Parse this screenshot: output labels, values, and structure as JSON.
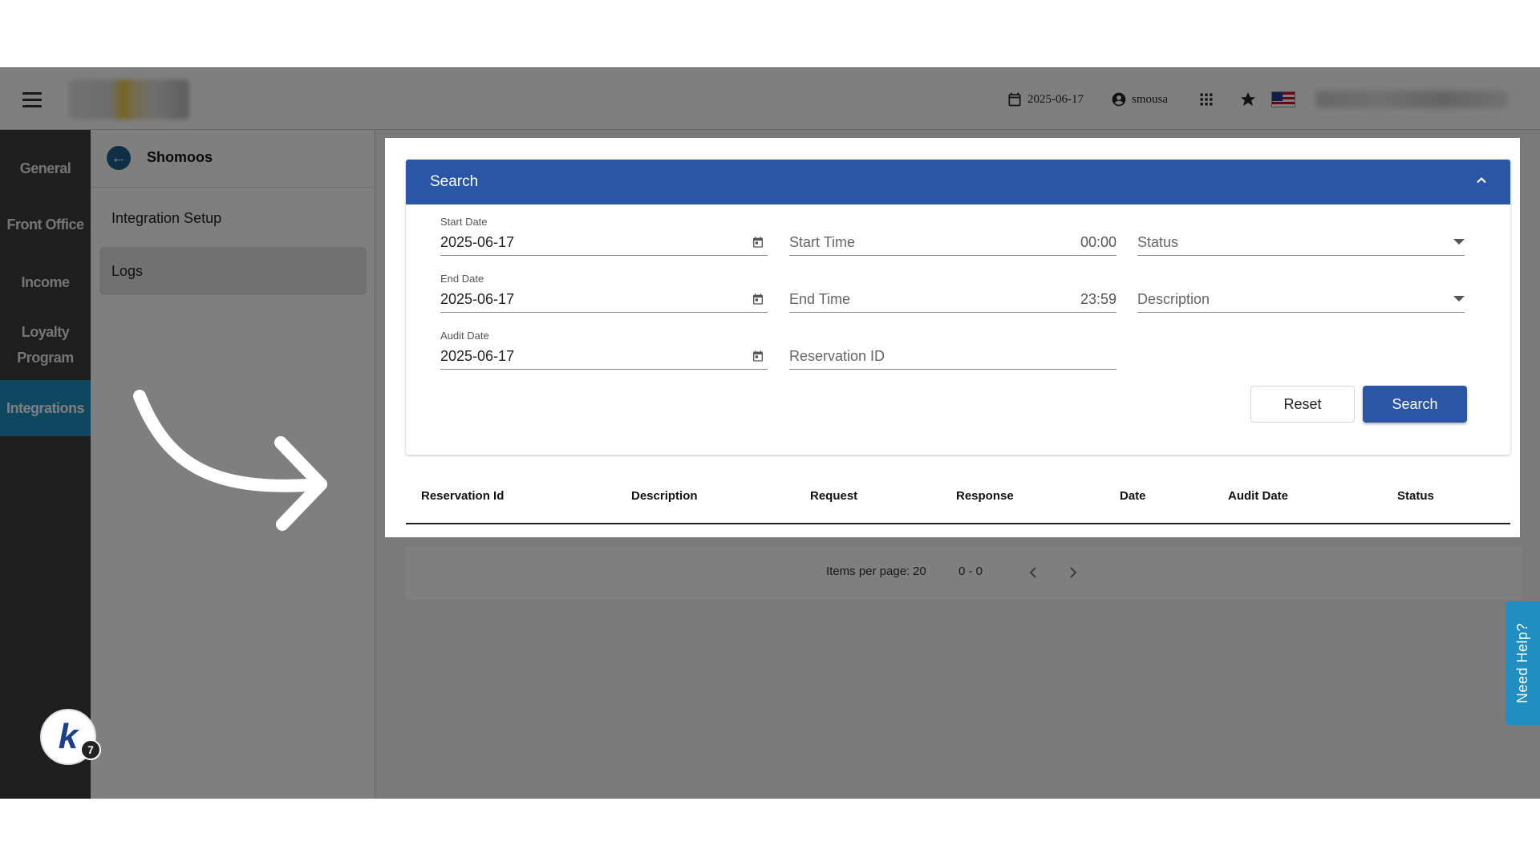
{
  "topbar": {
    "date": "2025-06-17",
    "user": "smousa"
  },
  "leftnav": {
    "items": [
      {
        "label": "General"
      },
      {
        "label": "Front Office"
      },
      {
        "label": "Income"
      },
      {
        "label": "Loyalty Program"
      },
      {
        "label": "Integrations"
      }
    ],
    "badge_count": "7"
  },
  "subnav": {
    "title": "Shomoos",
    "items": [
      {
        "label": "Integration Setup"
      },
      {
        "label": "Logs"
      }
    ]
  },
  "search": {
    "title": "Search",
    "start_date_label": "Start Date",
    "start_date": "2025-06-17",
    "end_date_label": "End Date",
    "end_date": "2025-06-17",
    "audit_date_label": "Audit Date",
    "audit_date": "2025-06-17",
    "start_time_label": "Start Time",
    "start_time": "00:00",
    "end_time_label": "End Time",
    "end_time": "23:59",
    "reservation_id_label": "Reservation ID",
    "status_label": "Status",
    "description_label": "Description",
    "reset_label": "Reset",
    "search_label": "Search"
  },
  "table": {
    "columns": [
      "Reservation Id",
      "Description",
      "Request",
      "Response",
      "Date",
      "Audit Date",
      "Status"
    ]
  },
  "paginator": {
    "items_per_page_label": "Items per page:",
    "items_per_page": "20",
    "range": "0 - 0"
  },
  "help": {
    "label": "Need Help?"
  },
  "colors": {
    "primary": "#2b56a6",
    "accent": "#1e8fc0",
    "sidebar": "#3c3c3c"
  }
}
